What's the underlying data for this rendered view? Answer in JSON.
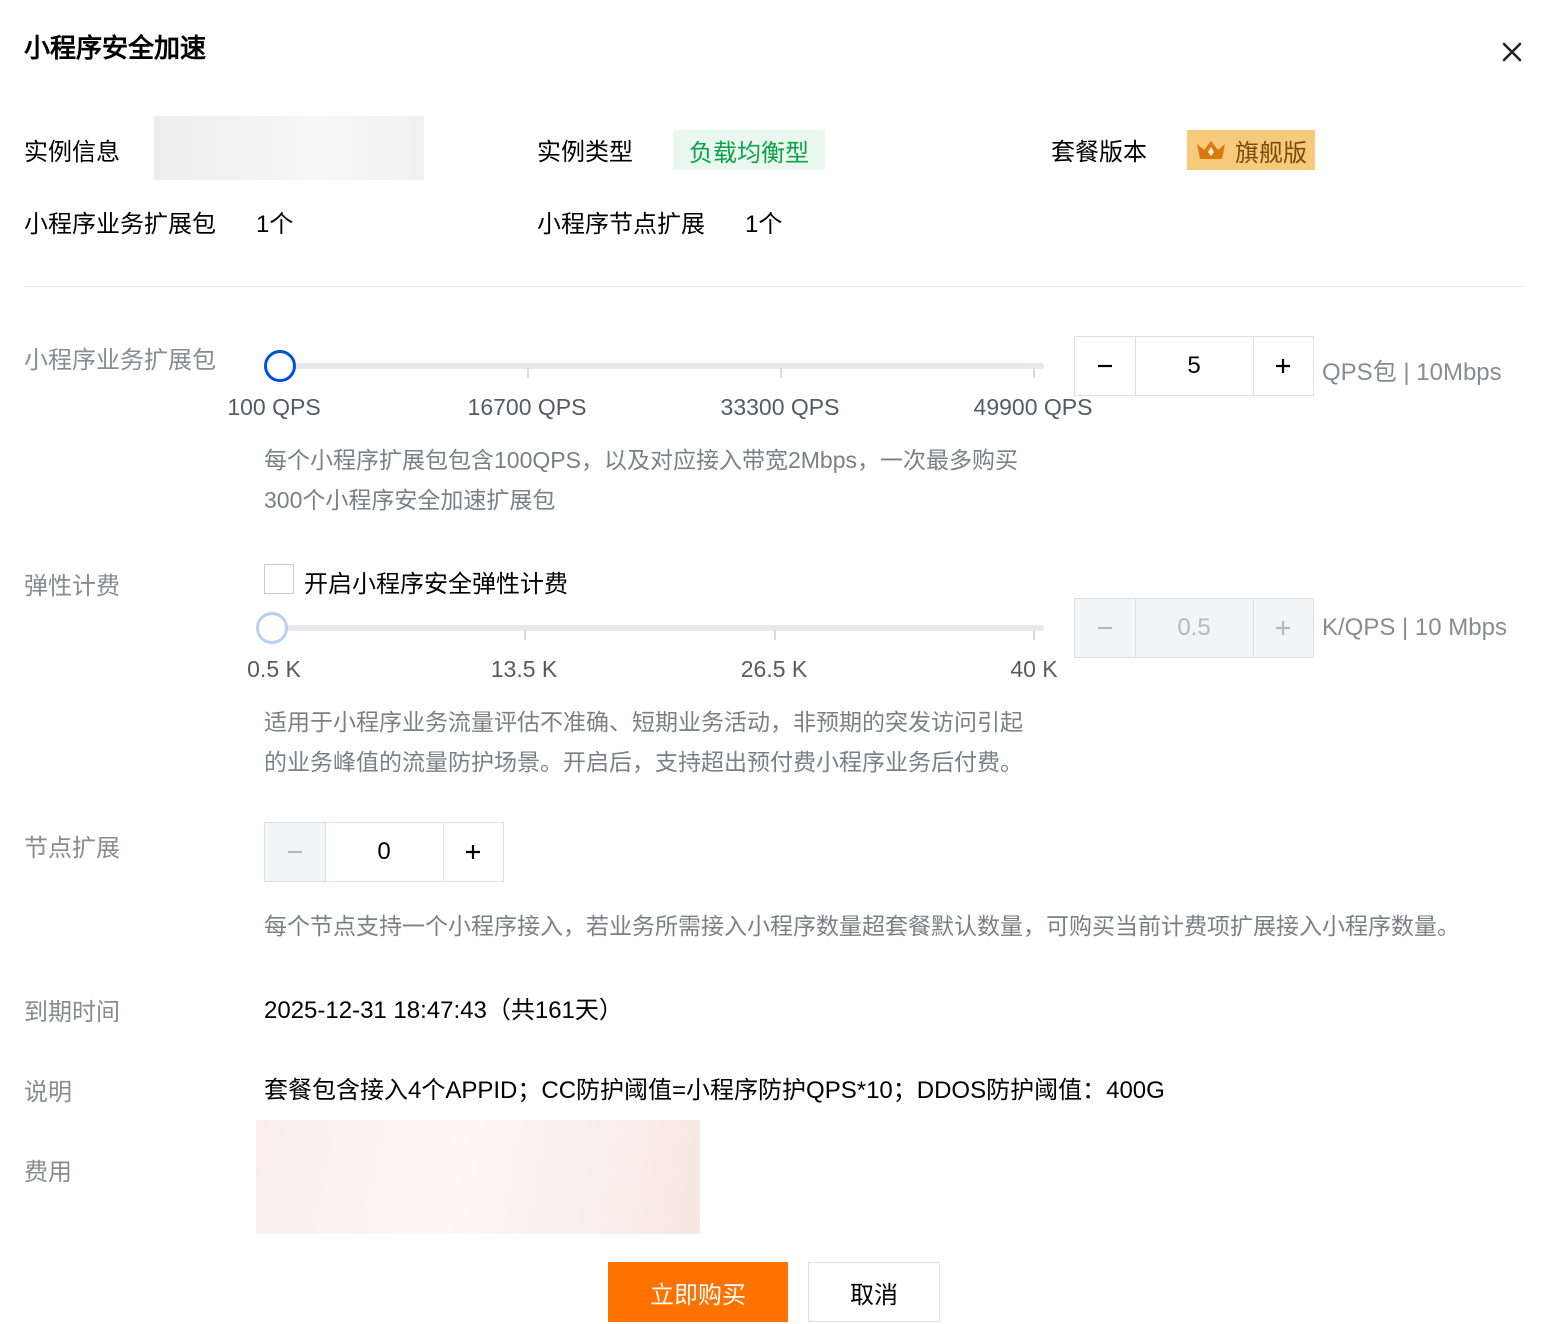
{
  "dialog": {
    "title": "小程序安全加速"
  },
  "info": {
    "instance_label": "实例信息",
    "type_label": "实例类型",
    "type_value": "负载均衡型",
    "plan_label": "套餐版本",
    "plan_value": "旗舰版",
    "biz_pack_label": "小程序业务扩展包",
    "biz_pack_value": "1个",
    "node_ext_label": "小程序节点扩展",
    "node_ext_value": "1个"
  },
  "biz_pack": {
    "label": "小程序业务扩展包",
    "ticks": [
      "100 QPS",
      "16700 QPS",
      "33300 QPS",
      "49900 QPS"
    ],
    "value": "5",
    "unit": "QPS包 | 10Mbps",
    "desc_line1": "每个小程序扩展包包含100QPS，以及对应接入带宽2Mbps，一次最多购买",
    "desc_line2": "300个小程序安全加速扩展包"
  },
  "elastic": {
    "label": "弹性计费",
    "checkbox_label": "开启小程序安全弹性计费",
    "checked": false,
    "ticks": [
      "0.5 K",
      "13.5 K",
      "26.5 K",
      "40 K"
    ],
    "value": "0.5",
    "unit": "K/QPS | 10 Mbps",
    "desc_line1": "适用于小程序业务流量评估不准确、短期业务活动，非预期的突发访问引起",
    "desc_line2": "的业务峰值的流量防护场景。开启后，支持超出预付费小程序业务后付费。"
  },
  "node_ext": {
    "label": "节点扩展",
    "value": "0",
    "desc": "每个节点支持一个小程序接入，若业务所需接入小程序数量超套餐默认数量，可购买当前计费项扩展接入小程序数量。"
  },
  "expiry": {
    "label": "到期时间",
    "value": "2025-12-31 18:47:43（共161天）"
  },
  "note": {
    "label": "说明",
    "value": "套餐包含接入4个APPID；CC防护阈值=小程序防护QPS*10；DDOS防护阈值：400G"
  },
  "fee": {
    "label": "费用"
  },
  "actions": {
    "buy": "立即购买",
    "cancel": "取消"
  },
  "icons": {
    "close": "close-icon",
    "minus": "minus-icon",
    "plus": "plus-icon",
    "crown": "crown-icon"
  },
  "colors": {
    "primary": "#ff7200",
    "accent_blue": "#0052d9",
    "green_tag": "#0ca14a",
    "gold_tag": "#f6c97b"
  }
}
